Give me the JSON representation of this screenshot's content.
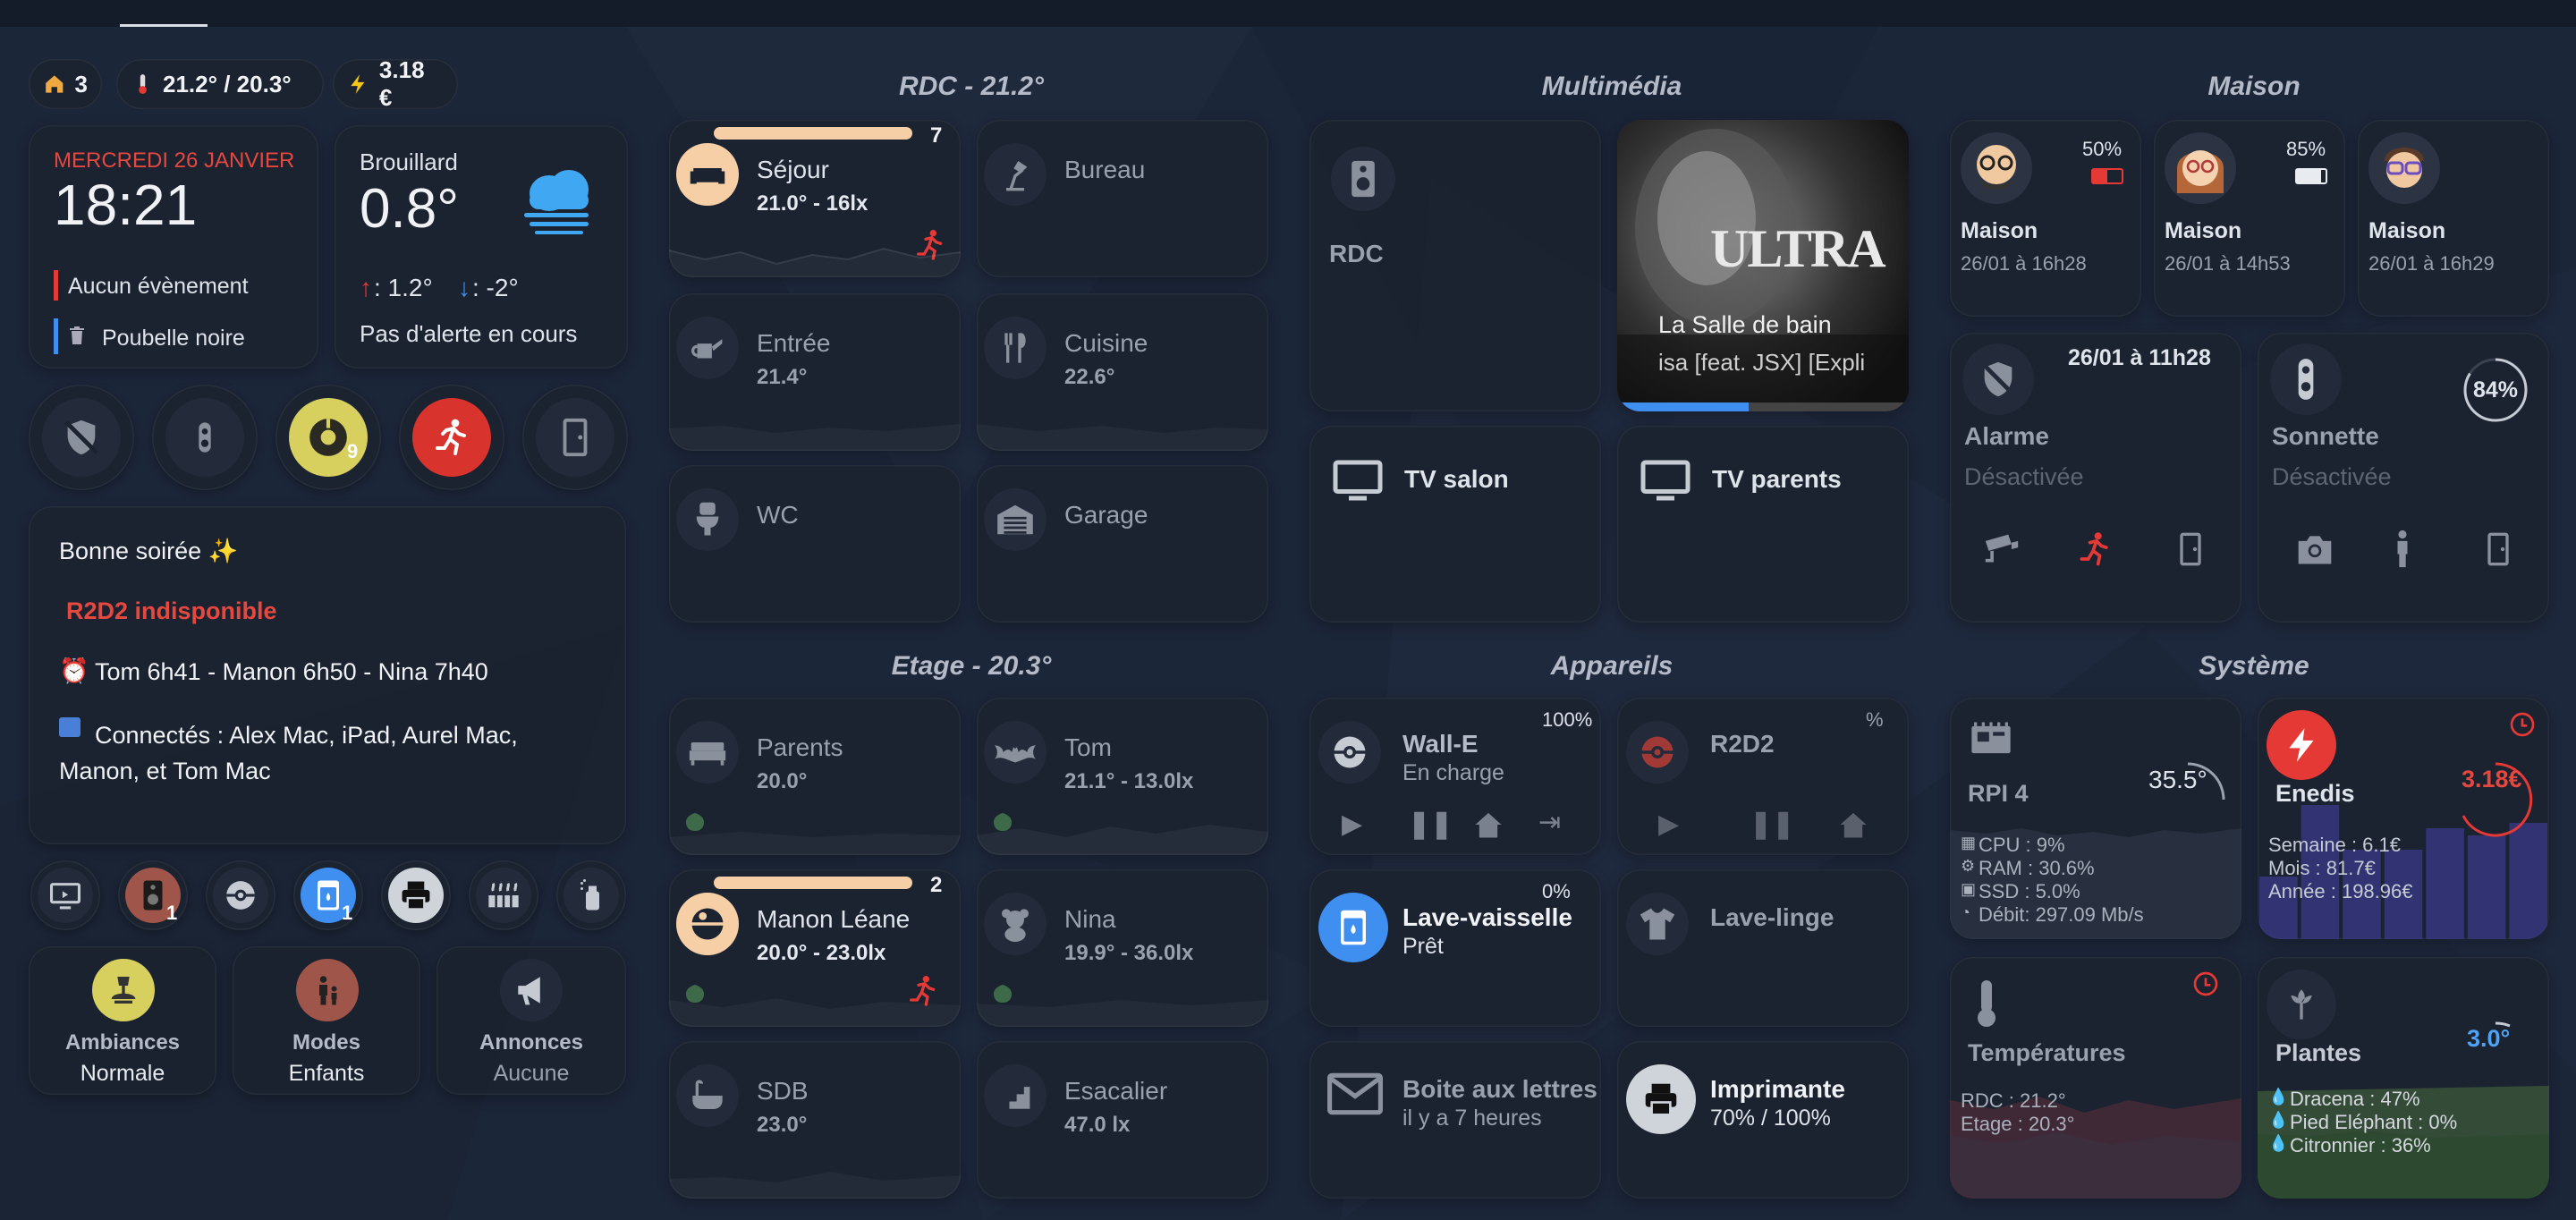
{
  "colors": {
    "bg": "#1c2639",
    "card": "#1b222f",
    "red": "#e53935",
    "blue": "#3f8ff0",
    "yellow": "#d7d05f",
    "peach": "#f7cfa6"
  },
  "pills": {
    "home_count": "3",
    "temp": "21.2° / 20.3°",
    "energy": "3.18 €"
  },
  "date": {
    "day": "MERCREDI 26 JANVIER",
    "time": "18:21",
    "event": "Aucun évènement",
    "trash": "Poubelle noire"
  },
  "weather": {
    "condition": "Brouillard",
    "temp": "0.8°",
    "high": ": 1.2°",
    "low": ": -2°",
    "alert": "Pas d'alerte en cours",
    "icon": "fog-cloud-icon"
  },
  "message": {
    "greeting": "Bonne soirée ✨",
    "warning": "R2D2 indisponible",
    "alarms": "Tom 6h41 - Manon 6h50 - Nina 7h40",
    "connected": "Connectés : Alex Mac, iPad, Aurel Mac, Manon, et Tom Mac"
  },
  "quick": {
    "vacuum_badge": "9",
    "speaker_badge": "1",
    "washer_badge": "1"
  },
  "modes": {
    "ambiances": {
      "label": "Ambiances",
      "value": "Normale"
    },
    "modes": {
      "label": "Modes",
      "value": "Enfants"
    },
    "annonces": {
      "label": "Annonces",
      "value": "Aucune"
    }
  },
  "sections": {
    "rdc": "RDC - 21.2°",
    "multimedia": "Multimédia",
    "maison": "Maison",
    "etage": "Etage - 20.3°",
    "appareils": "Appareils",
    "systeme": "Système"
  },
  "rooms": {
    "sejour": {
      "name": "Séjour",
      "sub": "21.0° - 16lx",
      "count": "7",
      "level": 0.9
    },
    "bureau": {
      "name": "Bureau",
      "sub": ""
    },
    "entree": {
      "name": "Entrée",
      "sub": "21.4°"
    },
    "cuisine": {
      "name": "Cuisine",
      "sub": "22.6°"
    },
    "wc": {
      "name": "WC",
      "sub": ""
    },
    "garage": {
      "name": "Garage",
      "sub": ""
    },
    "parents": {
      "name": "Parents",
      "sub": "20.0°"
    },
    "tom": {
      "name": "Tom",
      "sub": "21.1° - 13.0lx"
    },
    "manon": {
      "name": "Manon Léane",
      "sub": "20.0° - 23.0lx",
      "count": "2",
      "level": 0.9
    },
    "nina": {
      "name": "Nina",
      "sub": "19.9° - 36.0lx"
    },
    "sdb": {
      "name": "SDB",
      "sub": "23.0°"
    },
    "escalier": {
      "name": "Esacalier",
      "sub": "47.0 lx"
    }
  },
  "media": {
    "rdc": "RDC",
    "track": "La Salle de bain",
    "artist": "isa [feat. JSX] [Expli",
    "album_text": "ULTRA",
    "progress": 0.45,
    "tv_salon": "TV salon",
    "tv_parents": "TV parents"
  },
  "devices": {
    "walle": {
      "name": "Wall-E",
      "state": "En charge",
      "pct": "100%"
    },
    "r2d2": {
      "name": "R2D2",
      "pct": "%"
    },
    "dishwasher": {
      "name": "Lave-vaisselle",
      "state": "Prêt",
      "pct": "0%"
    },
    "washer": {
      "name": "Lave-linge"
    },
    "mailbox": {
      "name": "Boite aux lettres",
      "state": "il y a 7 heures"
    },
    "printer": {
      "name": "Imprimante",
      "state": "70% / 100%"
    }
  },
  "people": [
    {
      "name": "Maison",
      "time": "26/01 à 16h28",
      "battery": "50%",
      "battery_level": 0.5,
      "battery_color": "#e53935"
    },
    {
      "name": "Maison",
      "time": "26/01 à 14h53",
      "battery": "85%",
      "battery_level": 0.85,
      "battery_color": "#e8ebf0"
    },
    {
      "name": "Maison",
      "time": "26/01 à 16h29",
      "battery": "",
      "battery_level": 0,
      "battery_color": "#e8ebf0"
    }
  ],
  "alarm": {
    "time": "26/01 à 11h28",
    "name": "Alarme",
    "state": "Désactivée"
  },
  "doorbell": {
    "name": "Sonnette",
    "state": "Désactivée",
    "battery": "84%",
    "battery_level": 0.84
  },
  "rpi": {
    "name": "RPI 4",
    "temp": "35.5°",
    "cpu": "CPU : 9%",
    "ram": "RAM : 30.6%",
    "ssd": "SSD : 5.0%",
    "debit": "Débit: 297.09 Mb/s"
  },
  "enedis": {
    "name": "Enedis",
    "value": "3.18€",
    "week": "Semaine : 6.1€",
    "month": "Mois : 81.7€",
    "year": "Année : 198.96€",
    "bars": [
      0.35,
      0.75,
      0.5,
      0.5,
      0.62,
      0.58,
      0.65
    ]
  },
  "temps": {
    "name": "Températures",
    "rdc": "RDC : 21.2°",
    "etage": "Etage : 20.3°"
  },
  "plants": {
    "name": "Plantes",
    "value": "3.0°",
    "p1": "Dracena : 47%",
    "p2": "Pied Eléphant : 0%",
    "p3": "Citronnier : 36%"
  }
}
